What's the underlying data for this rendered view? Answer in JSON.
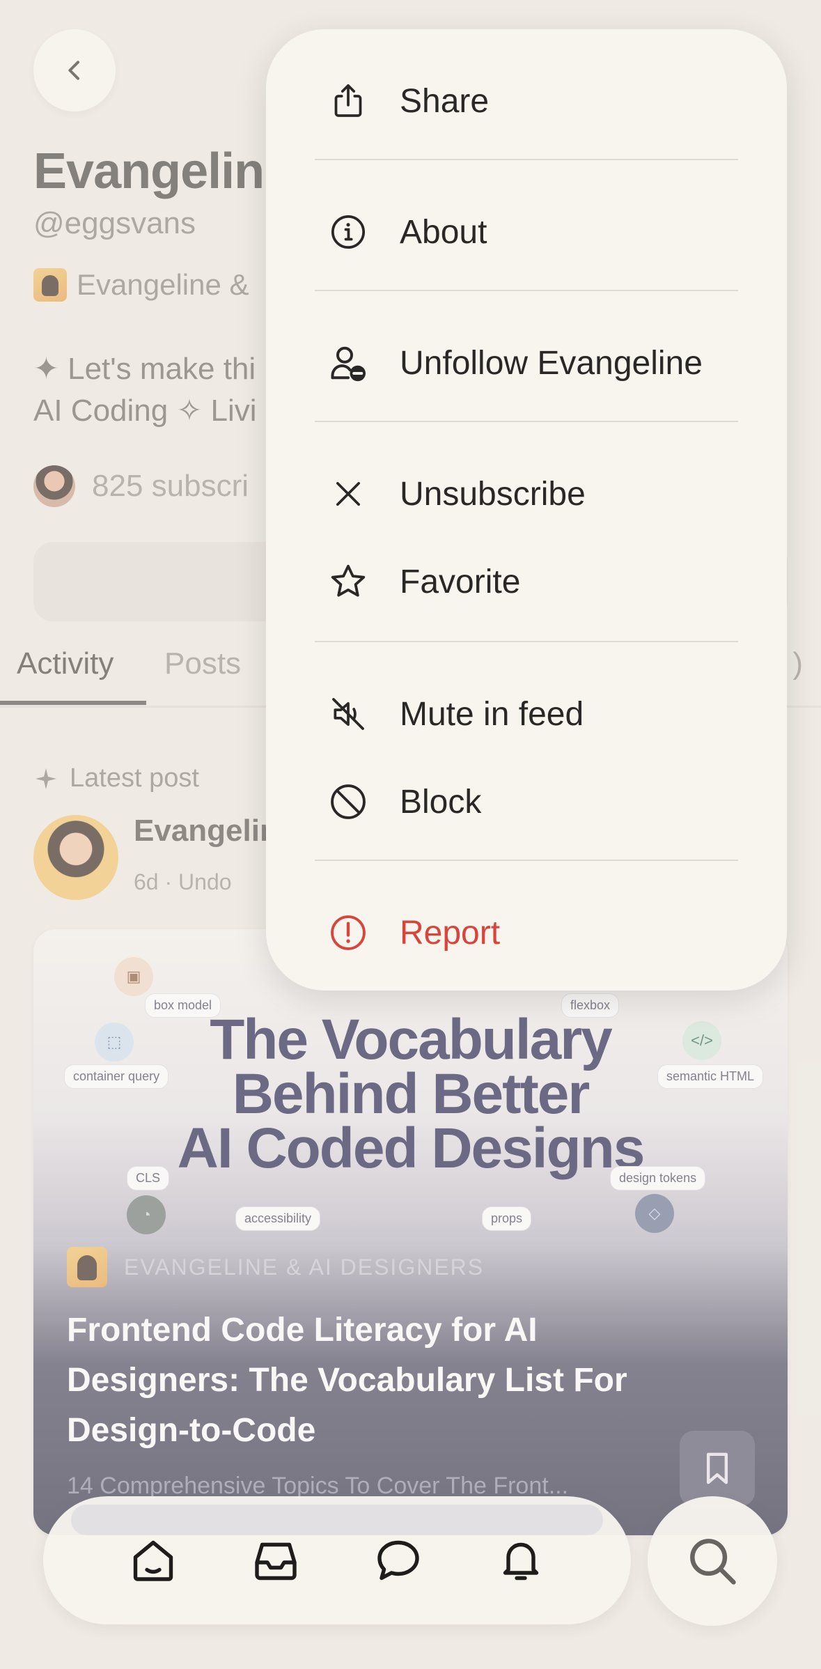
{
  "profile": {
    "name": "Evangelin",
    "handle": "@eggsvans",
    "publication": "Evangeline &",
    "bio_line1": "✦ Let's make thi",
    "bio_line2": "AI Coding ✧ Livi",
    "subscribers": "825 subscri"
  },
  "tabs": {
    "activity": "Activity",
    "posts": "Posts",
    "paren": ")"
  },
  "latest": {
    "label": "Latest post",
    "author": "Evangelin",
    "meta": "6d  ·  Undo"
  },
  "card": {
    "title_line1": "The Vocabulary",
    "title_line2": "Behind Better",
    "title_line3": "AI Coded Designs",
    "chips": {
      "box_model": "box model",
      "container_query": "container query",
      "flexbox": "flexbox",
      "semantic_html": "semantic HTML",
      "cls": "CLS",
      "accessibility": "accessibility",
      "props": "props",
      "design_tokens": "design tokens"
    },
    "publication": "EVANGELINE & AI DESIGNERS",
    "headline": "Frontend Code Literacy for AI Designers: The Vocabulary List For Design-to-Code",
    "subtitle": "14 Comprehensive Topics To Cover The Front..."
  },
  "menu": {
    "share": "Share",
    "about": "About",
    "unfollow": "Unfollow Evangeline",
    "unsubscribe": "Unsubscribe",
    "favorite": "Favorite",
    "mute": "Mute in feed",
    "block": "Block",
    "report": "Report"
  },
  "colors": {
    "background": "#efebe4",
    "menu_bg": "#f8f5ef",
    "danger": "#d8453c",
    "text": "#2a2826"
  },
  "icons": {
    "back": "chevron-left-icon",
    "share": "share-icon",
    "about": "info-icon",
    "unfollow": "user-minus-icon",
    "unsubscribe": "close-icon",
    "favorite": "star-icon",
    "mute": "muted-speaker-icon",
    "block": "block-icon",
    "report": "alert-icon",
    "nav": [
      "home-icon",
      "inbox-icon",
      "chat-icon",
      "bell-icon",
      "search-icon"
    ]
  }
}
